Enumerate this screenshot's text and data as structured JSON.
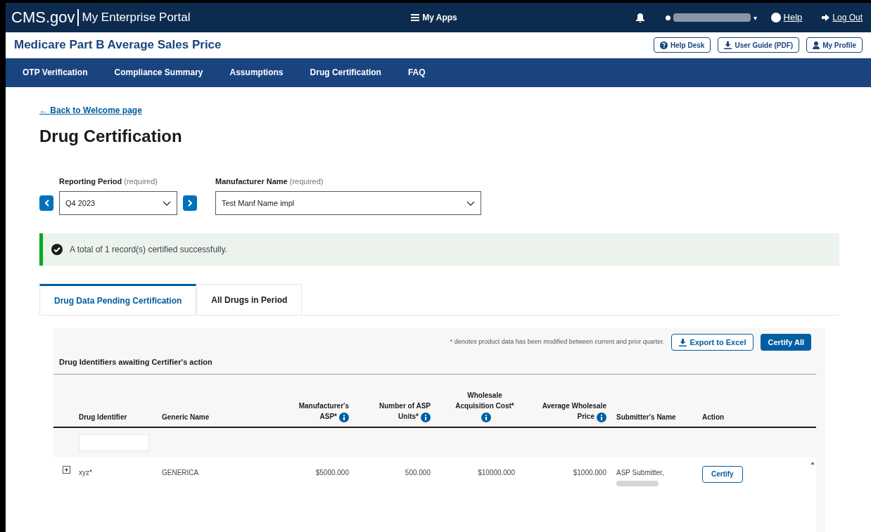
{
  "top_bar": {
    "logo": "CMS.gov",
    "portal": "My Enterprise Portal",
    "apps": "My Apps",
    "user_caret": "▾",
    "help": "Help",
    "logout": "Log Out"
  },
  "app_bar": {
    "title": "Medicare Part B Average Sales Price",
    "buttons": [
      {
        "label": "Help Desk",
        "kind": "help"
      },
      {
        "label": "User Guide (PDF)",
        "kind": "download"
      },
      {
        "label": "My Profile",
        "kind": "person"
      }
    ]
  },
  "nav": [
    {
      "label": "OTP Verification"
    },
    {
      "label": "Compliance Summary"
    },
    {
      "label": "Assumptions"
    },
    {
      "label": "Drug Certification"
    },
    {
      "label": "FAQ"
    }
  ],
  "back_arrow": "←",
  "back_link": "Back to Welcome page",
  "page_title": "Drug Certification",
  "filters": [
    {
      "label": "Reporting Period",
      "hint": "(required)",
      "value": "Q4 2023",
      "kind": "stepper"
    },
    {
      "label": "Manufacturer Name",
      "hint": "(required)",
      "value": "Test Manf Name impl",
      "kind": "select"
    }
  ],
  "alert": "A total of 1 record(s) certified successfully.",
  "tabs": [
    {
      "label": "Drug Data Pending Certification",
      "selected": true
    },
    {
      "label": "All Drugs in Period",
      "selected": false
    }
  ],
  "note": "* denotes product data has been modified between current and prior quarter.",
  "actions": [
    {
      "label": "Export to Excel",
      "kind": "outline"
    },
    {
      "label": "Certify All",
      "kind": "primary"
    }
  ],
  "table": {
    "caption": "Drug Identifiers awaiting Certifier's action",
    "columns": [
      {
        "label": "Drug Identifier",
        "info": false
      },
      {
        "label": "Generic Name",
        "info": false
      },
      {
        "label": "Manufacturer's ASP*",
        "info": true
      },
      {
        "label": "Number of ASP Units*",
        "info": true
      },
      {
        "label": "Wholesale Acquisition Cost*",
        "info": true
      },
      {
        "label": "Average Wholesale Price",
        "info": true
      },
      {
        "label": "Submitter's Name",
        "info": false
      },
      {
        "label": "Action",
        "info": false
      }
    ],
    "rows": [
      {
        "cells": [
          "xyz*",
          "GENERICA",
          "$5000.000",
          "500.000",
          "$10000.000",
          "$1000.000",
          "ASP Submitter,"
        ],
        "action": "Certify"
      }
    ]
  }
}
